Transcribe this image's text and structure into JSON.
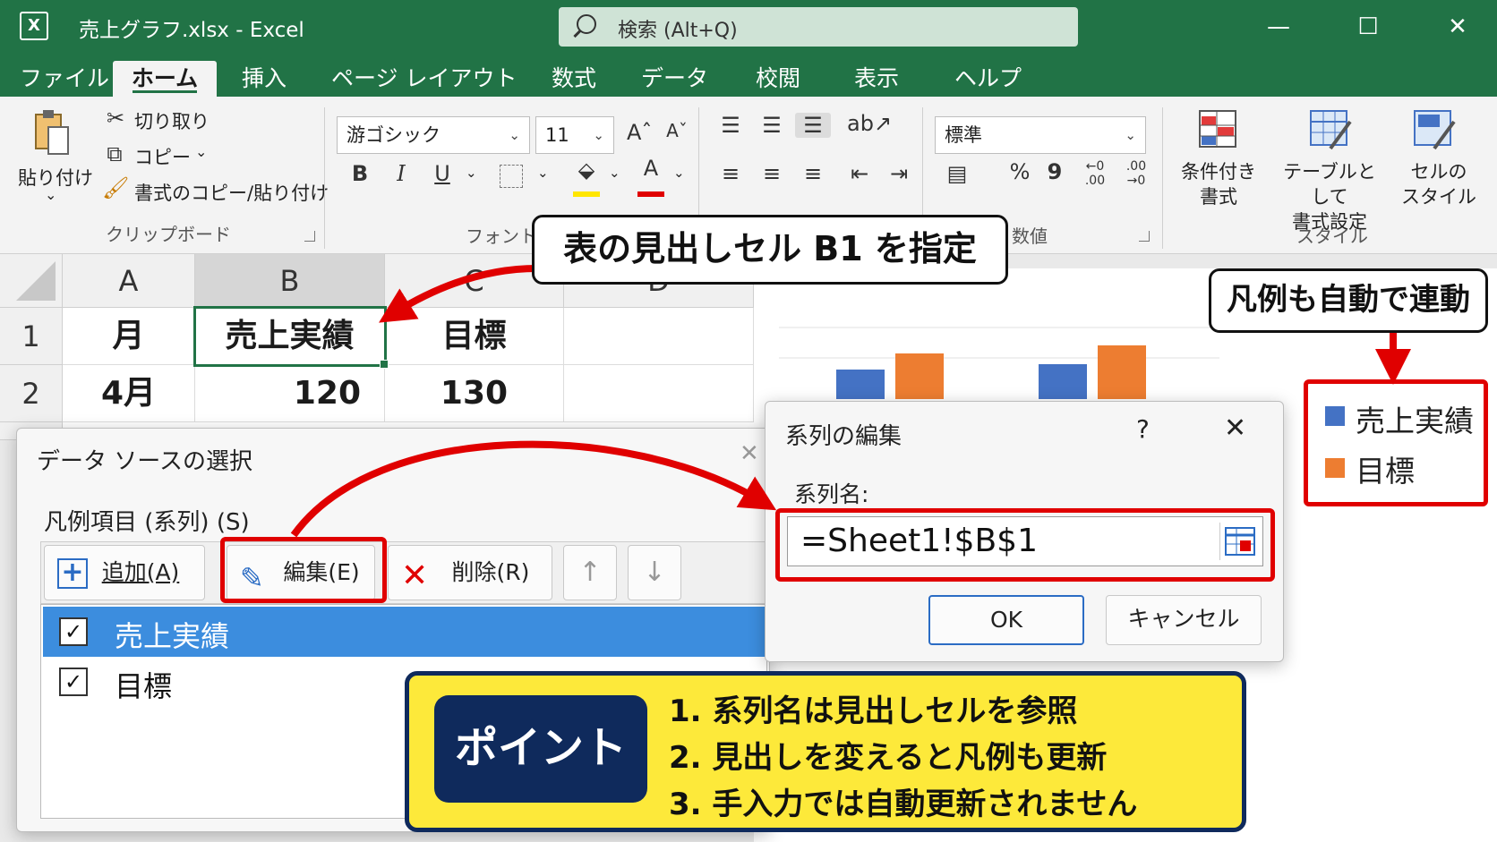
{
  "titlebar": {
    "app_icon": "X",
    "title": "売上グラフ.xlsx  -  Excel",
    "search_placeholder": "検索 (Alt+Q)",
    "minimize": "—",
    "maximize": "☐",
    "close": "✕"
  },
  "tabs": [
    "ファイル",
    "ホーム",
    "挿入",
    "ページ レイアウト",
    "数式",
    "データ",
    "校閲",
    "表示",
    "ヘルプ"
  ],
  "ribbon": {
    "clipboard": {
      "paste": "貼り付け",
      "paste_arrow": "⌄",
      "cut": "切り取り",
      "copy": "コピー",
      "copy_arrow": "⌄",
      "format_painter": "書式のコピー/貼り付け",
      "group_label": "クリップボード"
    },
    "font": {
      "font_name": "游ゴシック",
      "font_size": "11",
      "group_label": "フォント",
      "bold": "B",
      "italic": "I",
      "underline": "U"
    },
    "number": {
      "format": "標準",
      "percent": "%",
      "comma": "9",
      "group_label": "数値"
    },
    "styles": {
      "conditional": "条件付き\n書式",
      "table": "テーブルとして\n書式設定",
      "cell_styles": "セルの\nスタイル",
      "group_label": "スタイル"
    }
  },
  "sheet": {
    "columns": [
      "A",
      "B",
      "C",
      "D"
    ],
    "rows": [
      "1",
      "2"
    ],
    "cells": {
      "A1": "月",
      "B1": "売上実績",
      "C1": "目標",
      "A2": "4月",
      "B2": "120",
      "C2": "130"
    }
  },
  "chart_data": {
    "type": "bar",
    "categories": [
      "",
      ""
    ],
    "series": [
      {
        "name": "売上実績",
        "color": "#4472c4",
        "values": [
          0.55,
          0.65
        ]
      },
      {
        "name": "目標",
        "color": "#ed7d31",
        "values": [
          0.85,
          1.0
        ]
      }
    ],
    "legend_position": "right"
  },
  "datasource_dialog": {
    "title": "データ ソースの選択",
    "legend_label": "凡例項目 (系列) (S)",
    "add": "追加(A)",
    "edit": "編集(E)",
    "delete": "削除(R)",
    "up": "↑",
    "down": "↓",
    "series": [
      {
        "name": "売上実績",
        "checked": true,
        "selected": true
      },
      {
        "name": "目標",
        "checked": true,
        "selected": false
      }
    ]
  },
  "series_dialog": {
    "title": "系列の編集",
    "help": "?",
    "close": "✕",
    "name_label": "系列名:",
    "name_value": "=Sheet1!$B$1",
    "ok": "OK",
    "cancel": "キャンセル"
  },
  "annotations": {
    "b1_callout": "表の見出しセル B1 を指定",
    "legend_callout": "凡例も自動で連動",
    "point_badge": "ポイント",
    "points": [
      "1. 系列名は見出しセルを参照",
      "2. 見出しを変えると凡例も更新",
      "3. 手入力では自動更新されません"
    ]
  },
  "colors": {
    "excel_green": "#217346",
    "selection_blue": "#3c8dde",
    "highlight_red": "#e00000",
    "callout_yellow": "#fde93a",
    "badge_navy": "#0f2a5c"
  }
}
